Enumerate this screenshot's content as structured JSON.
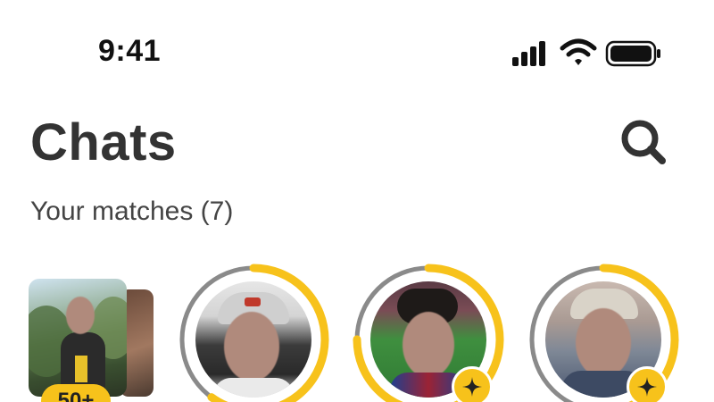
{
  "status_bar": {
    "time": "9:41",
    "signal_icon": "cellular-signal-icon",
    "wifi_icon": "wifi-icon",
    "battery_icon": "battery-icon"
  },
  "header": {
    "title": "Chats",
    "search_icon": "search-icon"
  },
  "matches": {
    "label": "Your matches (7)",
    "queue_badge": "50+",
    "items": [
      {
        "name": "match-1",
        "ring_progress": 0.6,
        "has_plus_badge": false
      },
      {
        "name": "match-2",
        "ring_progress": 0.75,
        "has_plus_badge": true
      },
      {
        "name": "match-3",
        "ring_progress": 0.55,
        "has_plus_badge": true
      }
    ]
  },
  "colors": {
    "accent": "#f7c21b",
    "ring_track": "#8a8a8a",
    "text": "#333333"
  }
}
